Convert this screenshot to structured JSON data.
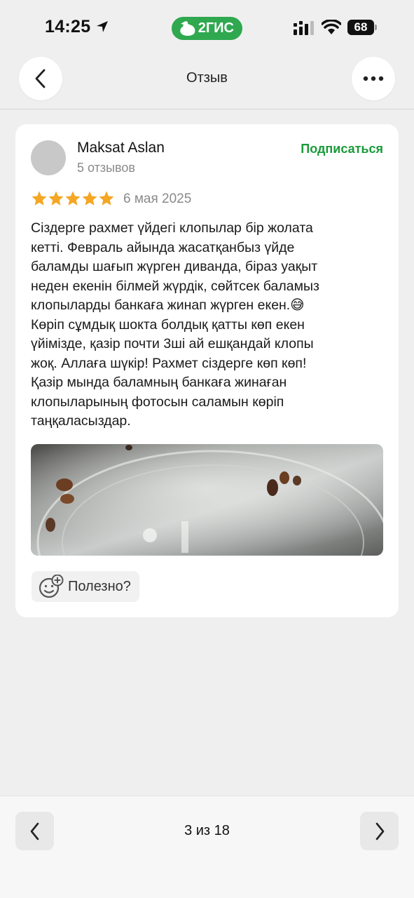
{
  "status_bar": {
    "time": "14:25",
    "app_badge": "2ГИС",
    "battery": "68"
  },
  "header": {
    "title": "Отзыв"
  },
  "review": {
    "author_name": "Maksat Aslan",
    "author_reviews": "5 отзывов",
    "subscribe_label": "Подписаться",
    "rating": 5,
    "date": "6 мая 2025",
    "text": "Сіздерге рахмет үйдегі клопылар бір жолата\nкетті. Февраль айында жасатқанбыз үйде\nбаламды шағып жүрген диванда, біраз уақыт\nнеден екенін білмей жүрдік, сөйтсек баламыз\nклопыларды банкаға жинап жүрген екен.😅\nКөріп сұмдық шокта болдық қатты көп екен\nүйімізде, қазір почти 3ші ай ешқандай клопы\nжоқ. Аллаға шүкір! Рахмет сіздерге көп көп!\nҚазір мында баламның банкаға жинаған\nклопыларының фотосын саламын көріп\nтаңқаласыздар.",
    "helpful_label": "Полезно?"
  },
  "pager": {
    "label": "3 из 18"
  },
  "colors": {
    "accent_green": "#1a9a3a",
    "brand_green": "#2fa84f",
    "star": "#f5a623"
  }
}
